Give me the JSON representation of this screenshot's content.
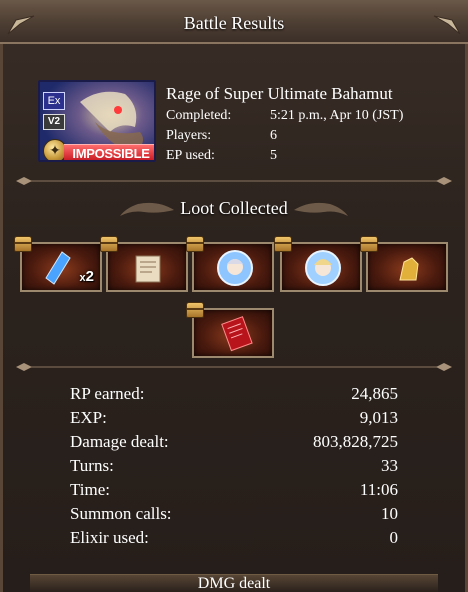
{
  "header": {
    "title": "Battle Results"
  },
  "quest": {
    "badge_ex": "Ex",
    "badge_v2": "V2",
    "badge_difficulty": "IMPOSSIBLE",
    "name": "Rage of Super Ultimate Bahamut",
    "completed_label": "Completed:",
    "completed_value": "5:21 p.m., Apr 10 (JST)",
    "players_label": "Players:",
    "players_value": "6",
    "ep_label": "EP used:",
    "ep_value": "5"
  },
  "loot": {
    "title": "Loot Collected",
    "items": [
      {
        "icon": "blue-crystal-icon",
        "count_prefix": "x",
        "count": "2"
      },
      {
        "icon": "scroll-icon"
      },
      {
        "icon": "character-orb-icon"
      },
      {
        "icon": "character-orb-icon"
      },
      {
        "icon": "gold-treasure-icon"
      },
      {
        "icon": "red-document-icon"
      }
    ]
  },
  "stats": {
    "rows": [
      {
        "label": "RP earned:",
        "value": "24,865"
      },
      {
        "label": "EXP:",
        "value": "9,013"
      },
      {
        "label": "Damage dealt:",
        "value": "803,828,725"
      },
      {
        "label": "Turns:",
        "value": "33"
      },
      {
        "label": "Time:",
        "value": "11:06"
      },
      {
        "label": "Summon calls:",
        "value": "10"
      },
      {
        "label": "Elixir used:",
        "value": "0"
      }
    ]
  },
  "footer": {
    "title": "DMG dealt"
  },
  "colors": {
    "accent_red": "#c4121c",
    "frame_gold": "#9d8a6e"
  }
}
